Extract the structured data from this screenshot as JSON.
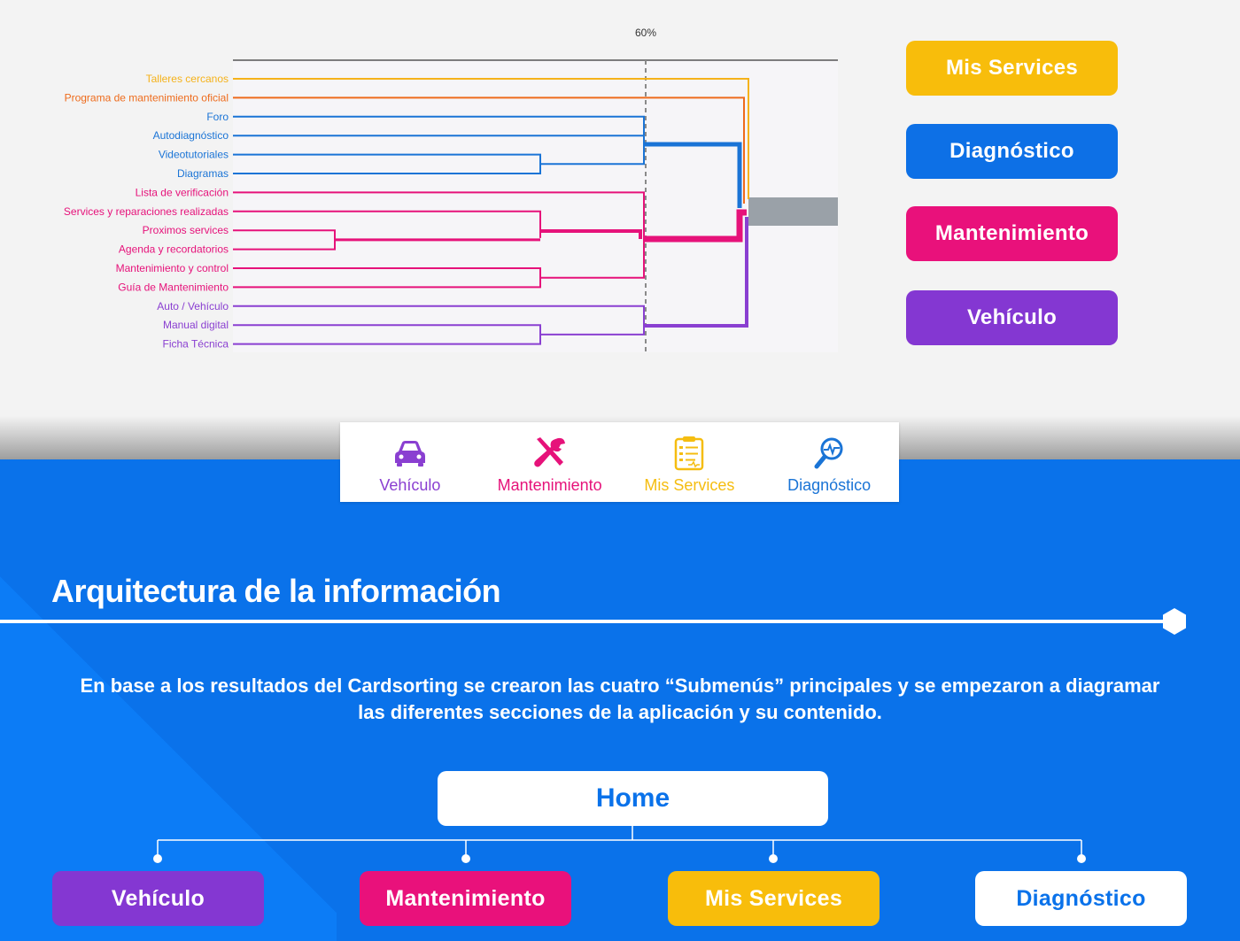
{
  "dendrogram": {
    "threshold_label": "60%",
    "items": [
      {
        "label": "Talleres cercanos",
        "color": "#f5b21a"
      },
      {
        "label": "Programa de mantenimiento oficial",
        "color": "#ee6b1c"
      },
      {
        "label": "Foro",
        "color": "#1a74d6"
      },
      {
        "label": "Autodiagnóstico",
        "color": "#1a74d6"
      },
      {
        "label": "Videotutoriales",
        "color": "#1a74d6"
      },
      {
        "label": "Diagramas",
        "color": "#1a74d6"
      },
      {
        "label": "Lista de verificación",
        "color": "#e6127a"
      },
      {
        "label": "Services y reparaciones realizadas",
        "color": "#e6127a"
      },
      {
        "label": "Proximos services",
        "color": "#e6127a"
      },
      {
        "label": "Agenda y recordatorios",
        "color": "#e6127a"
      },
      {
        "label": "Mantenimiento y control",
        "color": "#e6127a"
      },
      {
        "label": "Guía de Mantenimiento",
        "color": "#e6127a"
      },
      {
        "label": "Auto / Vehículo",
        "color": "#8a3fd1"
      },
      {
        "label": "Manual digital",
        "color": "#8a3fd1"
      },
      {
        "label": "Ficha Técnica",
        "color": "#8a3fd1"
      }
    ]
  },
  "categories": [
    {
      "label": "Mis Services",
      "color": "#f8bd0b"
    },
    {
      "label": "Diagnóstico",
      "color": "#0d70e6"
    },
    {
      "label": "Mantenimiento",
      "color": "#e9117b"
    },
    {
      "label": "Vehículo",
      "color": "#8437d2"
    }
  ],
  "tabbar": {
    "tabs": [
      {
        "label": "Vehículo",
        "icon": "car-icon",
        "color": "#8a3fd1"
      },
      {
        "label": "Mantenimiento",
        "icon": "tools-icon",
        "color": "#e6127a"
      },
      {
        "label": "Mis Services",
        "icon": "clipboard-icon",
        "color": "#f5bd10"
      },
      {
        "label": "Diagnóstico",
        "icon": "magnifier-pulse-icon",
        "color": "#1a74d6"
      }
    ]
  },
  "section": {
    "title": "Arquitectura de la información",
    "description": "En base a los resultados del Cardsorting se crearon las cuatro “Submenús” principales y se empezaron a diagramar las diferentes secciones  de la aplicación y su contenido."
  },
  "sitemap": {
    "root": "Home",
    "children": [
      {
        "label": "Vehículo",
        "bg": "#8437d2",
        "fg": "#ffffff"
      },
      {
        "label": "Mantenimiento",
        "bg": "#e9117b",
        "fg": "#ffffff"
      },
      {
        "label": "Mis Services",
        "bg": "#f8bd0b",
        "fg": "#ffffff"
      },
      {
        "label": "Diagnóstico",
        "bg": "#ffffff",
        "fg": "#0a72ea"
      }
    ]
  }
}
